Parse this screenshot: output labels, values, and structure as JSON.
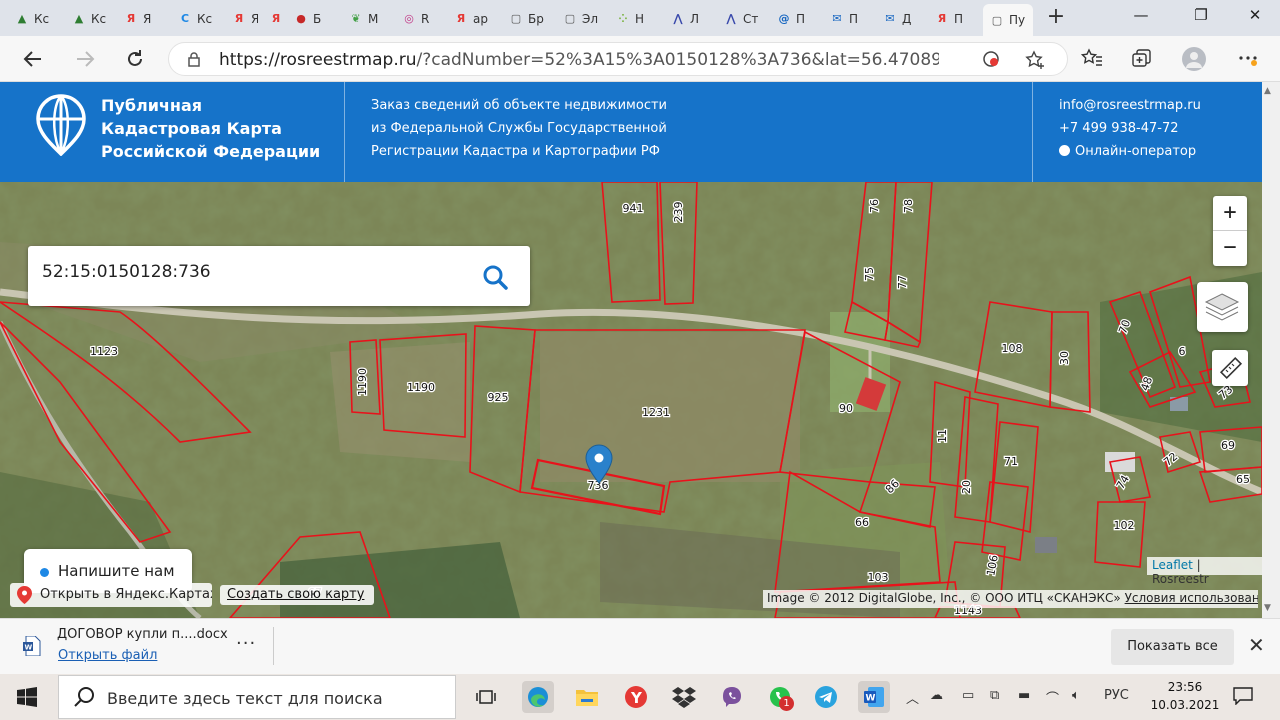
{
  "browser": {
    "tabs": [
      {
        "fav": "mountain-icon",
        "color": "#2e7d32",
        "label": "Кс"
      },
      {
        "fav": "mountain-icon",
        "color": "#2e7d32",
        "label": "Кс"
      },
      {
        "fav": "yandex-icon",
        "color": "#e53935",
        "label": "Я"
      },
      {
        "fav": "c-icon",
        "color": "#1e88e5",
        "label": "Кс"
      },
      {
        "fav": "yandex-icon",
        "color": "#e53935",
        "label": "Я"
      },
      {
        "fav": "yandex-icon",
        "color": "#e53935",
        "label": "к"
      },
      {
        "fav": "berries-icon",
        "color": "#c62828",
        "label": "Б"
      },
      {
        "fav": "leaf-icon",
        "color": "#43a047",
        "label": "М"
      },
      {
        "fav": "instagram-icon",
        "color": "#c13584",
        "label": "R"
      },
      {
        "fav": "yandex-icon",
        "color": "#e53935",
        "label": "ар"
      },
      {
        "fav": "page-icon",
        "color": "#555555",
        "label": "Бр"
      },
      {
        "fav": "page-icon",
        "color": "#555555",
        "label": "Эл"
      },
      {
        "fav": "dots-icon",
        "color": "#7cb342",
        "label": "Н"
      },
      {
        "fav": "avito-icon",
        "color": "#3949ab",
        "label": "Л"
      },
      {
        "fav": "avito-icon",
        "color": "#3949ab",
        "label": "Ст"
      },
      {
        "fav": "at-icon",
        "color": "#1565c0",
        "label": "П"
      },
      {
        "fav": "mail-icon",
        "color": "#1565c0",
        "label": "П"
      },
      {
        "fav": "mail-icon",
        "color": "#1565c0",
        "label": "Д"
      },
      {
        "fav": "yandex-icon",
        "color": "#e53935",
        "label": "П"
      },
      {
        "fav": "page-icon",
        "color": "#555555",
        "label": "Пу",
        "active": true
      }
    ],
    "new_tab": "+",
    "window": {
      "minimize": "—",
      "restore": "❐",
      "close": "✕"
    },
    "url_host": "https://rosreestrmap.ru",
    "url_rest": "/?cadNumber=52%3A15%3A0150128%3A736&lat=56.47089586..."
  },
  "site": {
    "title_lines": [
      "Публичная",
      "Кадастровая Карта",
      "Российской Федерации"
    ],
    "desc_lines": [
      "Заказ сведений об объекте недвижимости",
      "из Федеральной Службы Государственной",
      "Регистрации Кадастра и Картографии РФ"
    ],
    "email": "info@rosreestrmap.ru",
    "phone": "+7 499 938-47-72",
    "operator": "Онлайн-оператор",
    "accent": "#1673c9"
  },
  "map": {
    "search_value": "52:15:0150128:736",
    "zoom_in": "+",
    "zoom_out": "−",
    "chat_label": "Напишите нам",
    "yandex_label": "Открыть в Яндекс.Картах",
    "create_map": "Создать свою карту",
    "leaflet_link": "Leaflet",
    "leaflet_sep": " | Rosreestr",
    "imagery_attr": "Image © 2012 DigitalGlobe, Inc., © ООО ИТЦ «СКАНЭКС»",
    "terms_link": "Условия использования",
    "parcel_color": "#e8121b",
    "parcels": [
      "941",
      "239",
      "76",
      "78",
      "75",
      "77",
      "1123",
      "1190",
      "1190",
      "925",
      "1231",
      "736",
      "90",
      "108",
      "30",
      "70",
      "6",
      "48",
      "73",
      "11",
      "71",
      "20",
      "72",
      "69",
      "74",
      "65",
      "86",
      "66",
      "103",
      "106",
      "102",
      "67",
      "1143",
      "33"
    ]
  },
  "download": {
    "file_name": "ДОГОВОР купли п....docx",
    "open_label": "Открыть файл",
    "more": "···",
    "show_all": "Показать все",
    "close": "✕"
  },
  "taskbar": {
    "search_placeholder": "Введите здесь текст для поиска",
    "whatsapp_badge": "1",
    "lang": "РУС",
    "time": "23:56",
    "date": "10.03.2021"
  }
}
